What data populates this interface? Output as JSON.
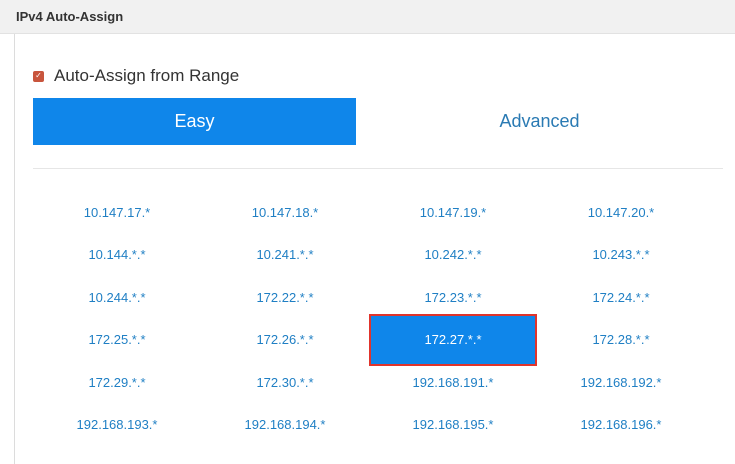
{
  "section": {
    "title": "IPv4 Auto-Assign"
  },
  "auto_assign": {
    "label": "Auto-Assign from Range",
    "checked": true
  },
  "tabs": [
    {
      "label": "Easy",
      "active": true
    },
    {
      "label": "Advanced",
      "active": false
    }
  ],
  "ranges": [
    "10.147.17.*",
    "10.147.18.*",
    "10.147.19.*",
    "10.147.20.*",
    "10.144.*.*",
    "10.241.*.*",
    "10.242.*.*",
    "10.243.*.*",
    "10.244.*.*",
    "172.22.*.*",
    "172.23.*.*",
    "172.24.*.*",
    "172.25.*.*",
    "172.26.*.*",
    "172.27.*.*",
    "172.28.*.*",
    "172.29.*.*",
    "172.30.*.*",
    "192.168.191.*",
    "192.168.192.*",
    "192.168.193.*",
    "192.168.194.*",
    "192.168.195.*",
    "192.168.196.*"
  ],
  "selected_range": "172.27.*.*",
  "colors": {
    "accent": "#0f86ea",
    "link": "#1f7fc4",
    "selection_border": "#e0342c",
    "checkbox": "#c8553d"
  }
}
